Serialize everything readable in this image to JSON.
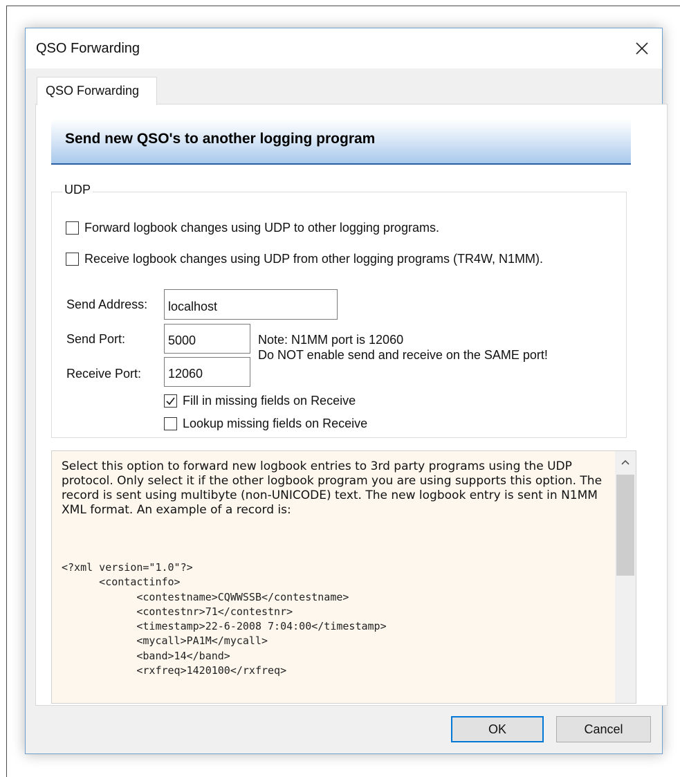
{
  "window": {
    "title": "QSO Forwarding",
    "close_icon": "close-icon"
  },
  "tabs": [
    {
      "label": "QSO Forwarding",
      "selected": true
    }
  ],
  "banner": {
    "text": "Send new QSO's to another logging program"
  },
  "udp_group": {
    "legend": "UDP",
    "forward_checkbox": {
      "label": "Forward logbook changes using UDP to other logging programs.",
      "checked": false
    },
    "receive_checkbox": {
      "label": "Receive logbook changes using UDP from other logging programs (TR4W, N1MM).",
      "checked": false
    },
    "send_address": {
      "label": "Send Address:",
      "value": "localhost"
    },
    "send_port": {
      "label": "Send Port:",
      "value": "5000"
    },
    "receive_port": {
      "label": "Receive Port:",
      "value": "12060"
    },
    "note_line1": "Note: N1MM port is 12060",
    "note_line2": "Do NOT enable send and receive on the SAME port!",
    "fill_missing_checkbox": {
      "label": "Fill in missing fields on Receive",
      "checked": true
    },
    "lookup_missing_checkbox": {
      "label": "Lookup missing fields on Receive",
      "checked": false
    }
  },
  "help": {
    "text": "Select this option to forward new logbook entries to 3rd party programs using the UDP protocol. Only select it if the other logbook program you are using supports this option. The record is sent using multibyte (non-UNICODE) text. The new logbook entry is sent in N1MM XML format. An example of a record is:",
    "xml_example": "<?xml version=\"1.0\"?>\n      <contactinfo>\n            <contestname>CQWWSSB</contestname>\n            <contestnr>71</contestnr>\n            <timestamp>22-6-2008 7:04:00</timestamp>\n            <mycall>PA1M</mycall>\n            <band>14</band>\n            <rxfreq>1420100</rxfreq>"
  },
  "buttons": {
    "ok": "OK",
    "cancel": "Cancel"
  },
  "colors": {
    "accent": "#0078d7",
    "banner_border": "#2a5ea0",
    "help_background": "#fdf7ee"
  }
}
